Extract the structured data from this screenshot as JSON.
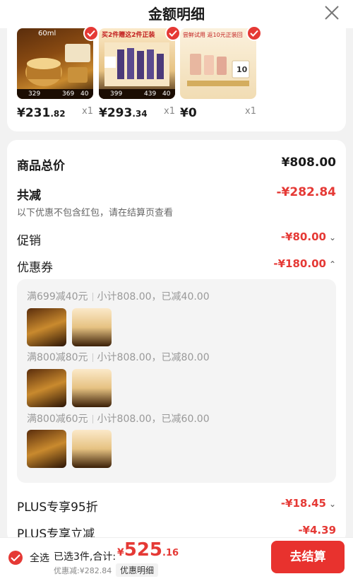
{
  "header": {
    "title": "金额明细"
  },
  "products": [
    {
      "price_main": "¥231",
      "price_dec": ".82",
      "qty": "x1",
      "thumb_text": "60ml",
      "thumb_price": "329",
      "thumb_sub": "369",
      "thumb_sub2": "40"
    },
    {
      "price_main": "¥293",
      "price_dec": ".34",
      "qty": "x1",
      "thumb_text": "买2件赠这2件正装",
      "thumb_price": "399",
      "thumb_sub": "439",
      "thumb_sub2": "40"
    },
    {
      "price_main": "¥0",
      "price_dec": "",
      "qty": "x1",
      "thumb_text": "尝鲜试用 返10元正装回",
      "thumb_price": "10",
      "thumb_sub": "",
      "thumb_sub2": ""
    }
  ],
  "summary": {
    "total_label": "商品总价",
    "total_value": "¥808.00",
    "reduce_label": "共减",
    "reduce_value": "-¥282.84",
    "reduce_note": "以下优惠不包含红包，请在结算页查看",
    "promo_label": "促销",
    "promo_value": "-¥80.00",
    "coupon_label": "优惠券",
    "coupon_value": "-¥180.00",
    "coupons": [
      {
        "rule": "满699减40元",
        "detail": "小计808.00，已减40.00"
      },
      {
        "rule": "满800减80元",
        "detail": "小计808.00，已减80.00"
      },
      {
        "rule": "满800减60元",
        "detail": "小计808.00，已减60.00"
      }
    ],
    "plus1_label": "PLUS专享95折",
    "plus1_value": "-¥18.45",
    "plus2_label": "PLUS专享立减",
    "plus2_value": "-¥4.39"
  },
  "bottom": {
    "select_all": "全选",
    "selected": "已选3件,合计:",
    "total_sym": "¥",
    "total_int": "525",
    "total_dec": ".16",
    "discount": "优惠减:¥282.84",
    "detail_btn": "优惠明细",
    "pay": "去结算"
  },
  "colors": {
    "accent": "#e53935",
    "pay": "#e8322e"
  }
}
